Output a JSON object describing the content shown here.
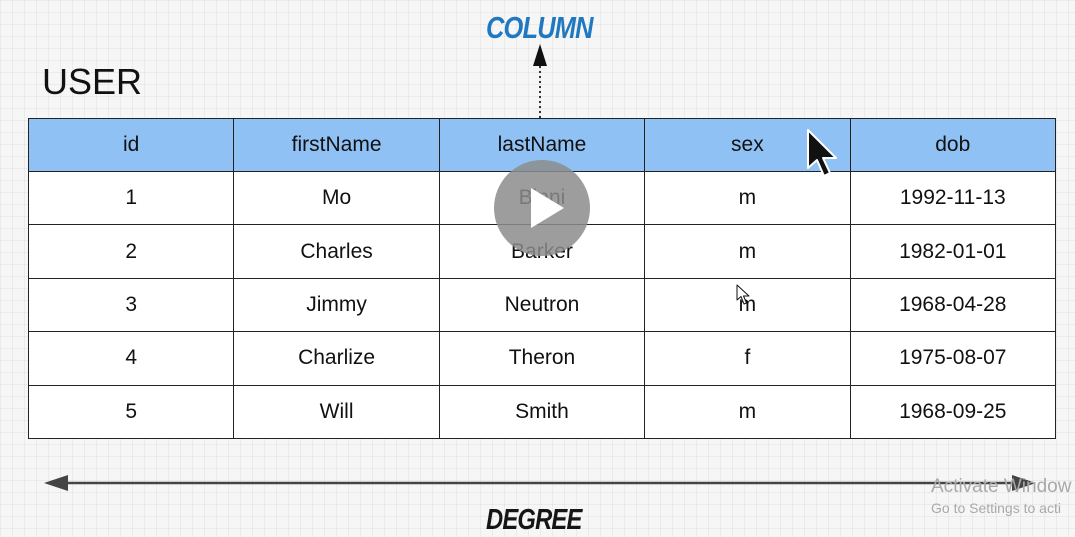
{
  "annotations": {
    "column_label": "COLUMN",
    "degree_label": "DEGREE"
  },
  "table": {
    "title": "USER",
    "columns": [
      "id",
      "firstName",
      "lastName",
      "sex",
      "dob"
    ],
    "rows": [
      [
        "1",
        "Mo",
        "Binni",
        "m",
        "1992-11-13"
      ],
      [
        "2",
        "Charles",
        "Barker",
        "m",
        "1982-01-01"
      ],
      [
        "3",
        "Jimmy",
        "Neutron",
        "m",
        "1968-04-28"
      ],
      [
        "4",
        "Charlize",
        "Theron",
        "f",
        "1975-08-07"
      ],
      [
        "5",
        "Will",
        "Smith",
        "m",
        "1968-09-25"
      ]
    ]
  },
  "watermark": {
    "title": "Activate Window",
    "subtitle": "Go to Settings to acti"
  },
  "icons": {
    "play": "play-icon",
    "cursor": "mouse-pointer-icon"
  },
  "colors": {
    "header_bg": "#8fc1f4",
    "column_label": "#1f78c0",
    "table_border": "#222222",
    "play_button": "#8c8c8c"
  }
}
